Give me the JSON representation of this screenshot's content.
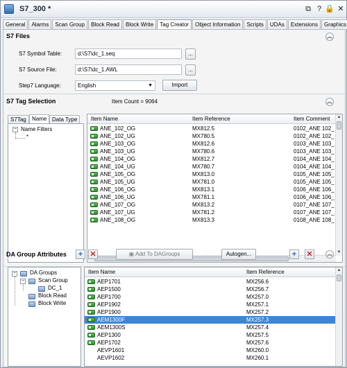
{
  "window": {
    "title": "S7_300 *",
    "controls": [
      "⧉",
      "?",
      "🔒",
      "✕"
    ]
  },
  "tabs": [
    "General",
    "Alarms",
    "Scan Group",
    "Block Read",
    "Block Write",
    "Tag Creator",
    "Object Information",
    "Scripts",
    "UDAs",
    "Extensions",
    "Graphics"
  ],
  "active_tab": "Tag Creator",
  "s7files": {
    "header": "S7 Files",
    "symbol_table_label": "S7 Symbol Table:",
    "symbol_table_value": "d:\\S7\\dc_1.seq",
    "source_file_label": "S7 Source File:",
    "source_file_value": "d:\\S7\\dc_1.AWL",
    "language_label": "Step7 Language:",
    "language_value": "English",
    "browse_label": "...",
    "import_label": "Import"
  },
  "tag_selection": {
    "header": "S7 Tag Selection",
    "item_count": "Item Count = 9064",
    "subtabs": [
      "S7Tag",
      "Name",
      "Data Type"
    ],
    "active_subtab": "Name",
    "tree_root": "Name Filters",
    "tree_child": "*",
    "columns": [
      "Item Name",
      "Item Reference",
      "Item Comment"
    ],
    "rows": [
      [
        "ANE_102_OG",
        "MX812.5",
        "0102_ANE 102_"
      ],
      [
        "ANE_102_UG",
        "MX780.5",
        "0102_ANE 102_"
      ],
      [
        "ANE_103_OG",
        "MX812.6",
        "0103_ANE 103_"
      ],
      [
        "ANE_103_UG",
        "MX780.6",
        "0103_ANE 103_"
      ],
      [
        "ANE_104_OG",
        "MX812.7",
        "0104_ANE 104_"
      ],
      [
        "ANE_104_UG",
        "MX780.7",
        "0104_ANE 104_"
      ],
      [
        "ANE_105_OG",
        "MX813.0",
        "0105_ANE 105_"
      ],
      [
        "ANE_105_UG",
        "MX781.0",
        "0105_ANE 105_"
      ],
      [
        "ANE_106_OG",
        "MX813.1",
        "0106_ANE 106_"
      ],
      [
        "ANE_106_UG",
        "MX781.1",
        "0106_ANE 106_"
      ],
      [
        "ANE_107_OG",
        "MX813.2",
        "0107_ANE 107_"
      ],
      [
        "ANE_107_UG",
        "MX781.2",
        "0107_ANE 107_"
      ],
      [
        "ANE_108_OG",
        "MX813.3",
        "0108_ANE 108_"
      ]
    ]
  },
  "da_group": {
    "header": "DA Group Attributes",
    "add_to_dagroups": "Add To DAGroups",
    "autogen": "Autogen...",
    "tree": {
      "root": "DA Groups",
      "scan_group": "Scan Group",
      "dc1": "DC_1",
      "block_read": "Block Read",
      "block_write": "Block Write"
    },
    "columns": [
      "Item Name",
      "Item Reference"
    ],
    "rows": [
      [
        "AEP1701",
        "MX256.6"
      ],
      [
        "AEP1500",
        "MX256.7"
      ],
      [
        "AEP1700",
        "MX257.0"
      ],
      [
        "AEP1902",
        "MX257.1"
      ],
      [
        "AEP1900",
        "MX257.2"
      ],
      [
        "AEM1300F",
        "MX257.3"
      ],
      [
        "AEM1300S",
        "MX257.4"
      ],
      [
        "AEP1300",
        "MX257.5"
      ],
      [
        "AEP1702",
        "MX257.6"
      ],
      [
        "AEVP1601",
        "MX260.0"
      ],
      [
        "AEVP1602",
        "MX260.1"
      ]
    ],
    "selected_row": 5
  }
}
